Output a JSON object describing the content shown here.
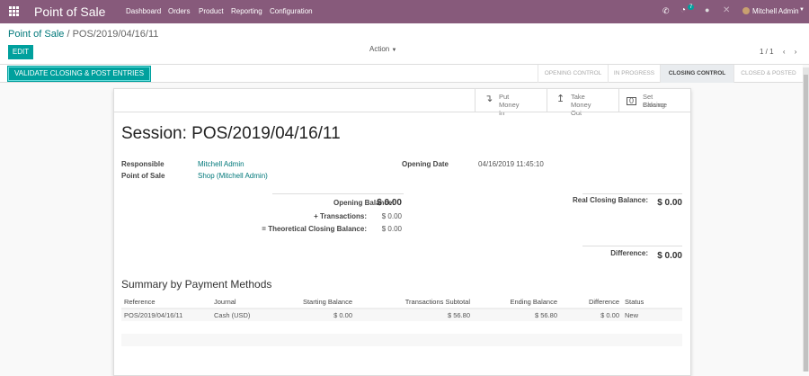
{
  "navbar": {
    "app_title": "Point of Sale",
    "menu": [
      "Dashboard",
      "Orders",
      "Product",
      "Reporting",
      "Configuration"
    ],
    "activity_count": "7",
    "user": "Mitchell Admin"
  },
  "breadcrumb": {
    "parent": "Point of Sale",
    "current": "POS/2019/04/16/11"
  },
  "control": {
    "edit_label": "EDIT",
    "action_label": "Action",
    "pager": "1 / 1"
  },
  "statusbar": {
    "validate_label": "VALIDATE CLOSING & POST ENTRIES",
    "stages": [
      "OPENING CONTROL",
      "IN PROGRESS",
      "CLOSING CONTROL",
      "CLOSED & POSTED"
    ],
    "current_stage": "CLOSING CONTROL"
  },
  "buttons": [
    {
      "line1": "Put",
      "line2": "Money In"
    },
    {
      "line1": "Take",
      "line2": "Money Out"
    },
    {
      "line1": "Set Closing",
      "line2": "Balance"
    }
  ],
  "session": {
    "title": "Session: POS/2019/04/16/11",
    "responsible_label": "Responsible",
    "responsible": "Mitchell Admin",
    "pos_label": "Point of Sale",
    "pos": "Shop (Mitchell Admin)",
    "opening_date_label": "Opening Date",
    "opening_date": "04/16/2019 11:45:10"
  },
  "balances": {
    "opening_label": "Opening Balance:",
    "opening": "$ 0.00",
    "transactions_label": "+ Transactions:",
    "transactions": "$ 0.00",
    "theoretical_label": "= Theoretical Closing Balance:",
    "theoretical": "$ 0.00",
    "real_label": "Real Closing Balance:",
    "real": "$ 0.00",
    "difference_label": "Difference:",
    "difference": "$ 0.00"
  },
  "summary": {
    "title": "Summary by Payment Methods",
    "headers": [
      "Reference",
      "Journal",
      "Starting Balance",
      "Transactions Subtotal",
      "Ending Balance",
      "Difference",
      "Status"
    ],
    "rows": [
      [
        "POS/2019/04/16/11",
        "Cash (USD)",
        "$ 0.00",
        "$ 56.80",
        "$ 56.80",
        "$ 0.00",
        "New"
      ]
    ]
  }
}
